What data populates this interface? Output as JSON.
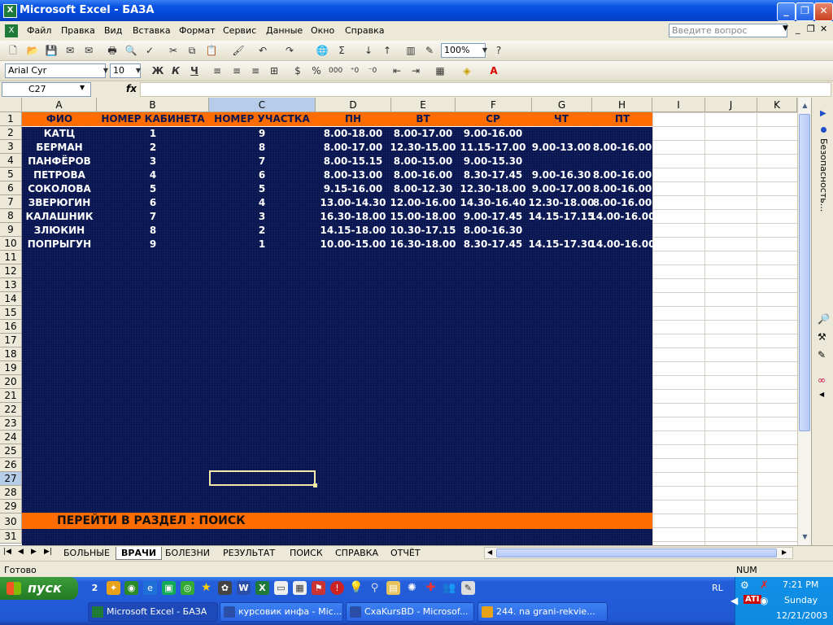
{
  "window": {
    "title": "Microsoft Excel - БАЗА"
  },
  "menu": [
    "Файл",
    "Правка",
    "Вид",
    "Вставка",
    "Формат",
    "Сервис",
    "Данные",
    "Окно",
    "Справка"
  ],
  "ask_placeholder": "Введите вопрос",
  "toolbar": {
    "zoom": "100%",
    "font": "Arial Cyr",
    "size": "10",
    "bold": "Ж",
    "italic": "К",
    "underline": "Ч"
  },
  "formula": {
    "namebox": "C27",
    "fx": "fx",
    "value": ""
  },
  "columns": [
    "A",
    "B",
    "C",
    "D",
    "E",
    "F",
    "G",
    "H",
    "I",
    "J",
    "K"
  ],
  "rows": [
    "1",
    "2",
    "3",
    "4",
    "5",
    "6",
    "7",
    "8",
    "9",
    "10",
    "11",
    "12",
    "13",
    "14",
    "15",
    "16",
    "17",
    "18",
    "19",
    "20",
    "21",
    "22",
    "23",
    "24",
    "25",
    "26",
    "27",
    "28",
    "29",
    "30",
    "31"
  ],
  "table": {
    "headers": [
      "ФИО",
      "НОМЕР КАБИНЕТА",
      "НОМЕР УЧАСТКА",
      "ПН",
      "ВТ",
      "СР",
      "ЧТ",
      "ПТ"
    ],
    "rows": [
      [
        "КАТЦ",
        "1",
        "9",
        "8.00-18.00",
        "8.00-17.00",
        "9.00-16.00",
        "",
        ""
      ],
      [
        "БЕРМАН",
        "2",
        "8",
        "8.00-17.00",
        "12.30-15.00",
        "11.15-17.00",
        "9.00-13.00",
        "8.00-16.00"
      ],
      [
        "ПАНФЁРОВ",
        "3",
        "7",
        "8.00-15.15",
        "8.00-15.00",
        "9.00-15.30",
        "",
        ""
      ],
      [
        "ПЕТРОВА",
        "4",
        "6",
        "8.00-13.00",
        "8.00-16.00",
        "8.30-17.45",
        "9.00-16.30",
        "8.00-16.00"
      ],
      [
        "СОКОЛОВА",
        "5",
        "5",
        "9.15-16.00",
        "8.00-12.30",
        "12.30-18.00",
        "9.00-17.00",
        "8.00-16.00"
      ],
      [
        "ЗВЕРЮГИН",
        "6",
        "4",
        "13.00-14.30",
        "12.00-16.00",
        "14.30-16.40",
        "12.30-18.00",
        "8.00-16.00"
      ],
      [
        "КАЛАШНИК",
        "7",
        "3",
        "16.30-18.00",
        "15.00-18.00",
        "9.00-17.45",
        "14.15-17.15",
        "14.00-16.00"
      ],
      [
        "ЗЛЮКИН",
        "8",
        "2",
        "14.15-18.00",
        "10.30-17.15",
        "8.00-16.30",
        "",
        ""
      ],
      [
        "ПОПРЫГУН",
        "9",
        "1",
        "10.00-15.00",
        "16.30-18.00",
        "8.30-17.45",
        "14.15-17.30",
        "14.00-16.00"
      ]
    ]
  },
  "goto_link": "ПЕРЕЙТИ В РАЗДЕЛ : ПОИСК",
  "taskpane_label": "Безопасность...",
  "sheet_tabs": [
    "БОЛЬНЫЕ",
    "ВРАЧИ",
    "БОЛЕЗНИ",
    "РЕЗУЛЬТАТ",
    "ПОИСК",
    "СПРАВКА",
    "ОТЧЁТ"
  ],
  "active_tab": "ВРАЧИ",
  "status": {
    "left": "Готово",
    "num": "NUM"
  },
  "taskbar": {
    "start": "пуск",
    "lang": "RL",
    "tasks": [
      "Microsoft Excel - БАЗА",
      "курсовик инфа - Mic...",
      "CxaKursBD - Microsof...",
      "244. na grani-rekvie..."
    ],
    "time": "7:21 PM",
    "day": "Sunday",
    "date": "12/21/2003"
  },
  "colors": {
    "navy": "#0b1750",
    "orange": "#ff6c00",
    "taskbar": "#245edb"
  }
}
